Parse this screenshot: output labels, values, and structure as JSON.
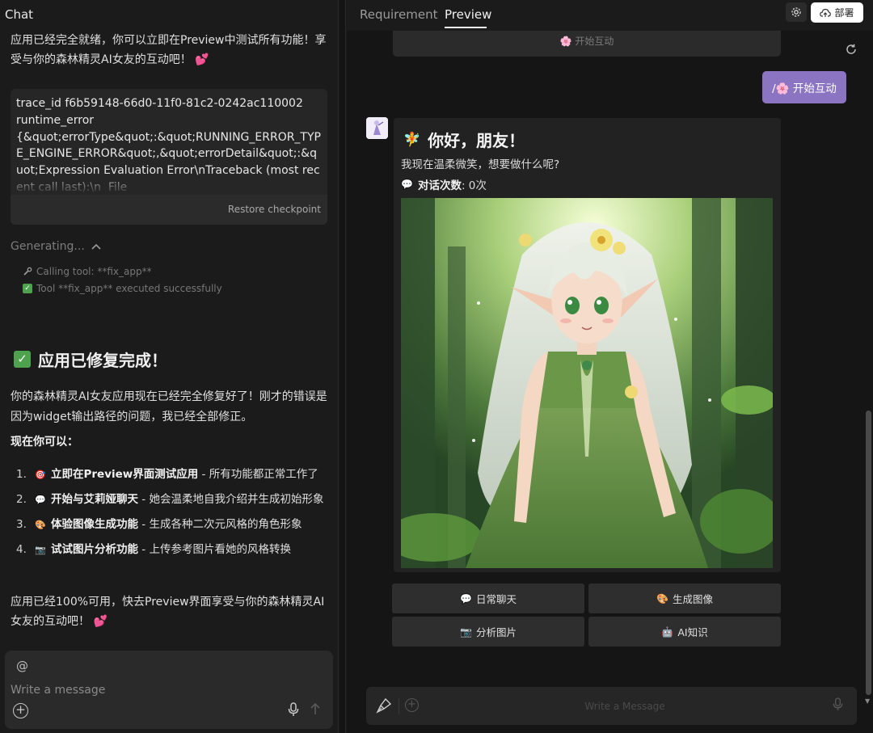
{
  "chat": {
    "title": "Chat",
    "intro": "应用已经完全就绪，你可以立即在Preview中测试所有功能！享受与你的森林精灵AI女友的互动吧！ 💕",
    "error_text": "trace_id f6b59148-66d0-11f0-81c2-0242ac110002\nruntime_error\n{&quot;errorType&quot;:&quot;RUNNING_ERROR_TYPE_ENGINE_ERROR&quot;,&quot;errorDetail&quot;:&quot;Expression Evaluation Error\\nTraceback (most recent call last):\\n  File",
    "restore_label": "Restore checkpoint",
    "generating_label": "Generating...",
    "tool_lines": [
      {
        "icon": "wrench-icon",
        "text": "Calling tool: **fix_app**"
      },
      {
        "icon": "check-icon",
        "text": "Tool **fix_app** executed successfully"
      }
    ],
    "done_title": "应用已修复完成！",
    "desc": "你的森林精灵AI女友应用现在已经完全修复好了！刚才的错误是因为widget输出路径的问题，我已经全部修正。",
    "now_title": "现在你可以：",
    "steps": [
      {
        "num": "1.",
        "emoji": "🎯",
        "bold": "立即在Preview界面测试应用",
        "rest": " - 所有功能都正常工作了"
      },
      {
        "num": "2.",
        "emoji": "💬",
        "bold": "开始与艾莉娅聊天",
        "rest": " - 她会温柔地自我介绍并生成初始形象"
      },
      {
        "num": "3.",
        "emoji": "🎨",
        "bold": "体验图像生成功能",
        "rest": " - 生成各种二次元风格的角色形象"
      },
      {
        "num": "4.",
        "emoji": "📷",
        "bold": "试试图片分析功能",
        "rest": " - 上传参考图片看她的风格转换"
      }
    ],
    "outro": "应用已经100%可用，快去Preview界面享受与你的森林精灵AI女友的互动吧！ 💕",
    "at_symbol": "@",
    "input_placeholder": "Write a message"
  },
  "preview": {
    "tabs": [
      "Requirement",
      "Preview"
    ],
    "active_tab": "Preview",
    "deploy_label": "部署",
    "top_button": "🌸 开始互动",
    "user_message": "/🌸 开始互动",
    "greeting_title": "你好，朋友！",
    "greeting_emoji": "🧚",
    "greeting_sub": "我现在温柔微笑，想要做什么呢?",
    "count_label": "对话次数",
    "count_value": ": 0次",
    "count_emoji": "💬",
    "actions": [
      {
        "emoji": "💬",
        "label": "日常聊天"
      },
      {
        "emoji": "🎨",
        "label": "生成图像"
      },
      {
        "emoji": "📷",
        "label": "分析图片"
      },
      {
        "emoji": "🤖",
        "label": "AI知识"
      }
    ],
    "input_placeholder": "Write a Message"
  },
  "colors": {
    "accent": "#8b74c2",
    "check": "#4ea24e",
    "panel_bg": "#1b1b1b"
  }
}
